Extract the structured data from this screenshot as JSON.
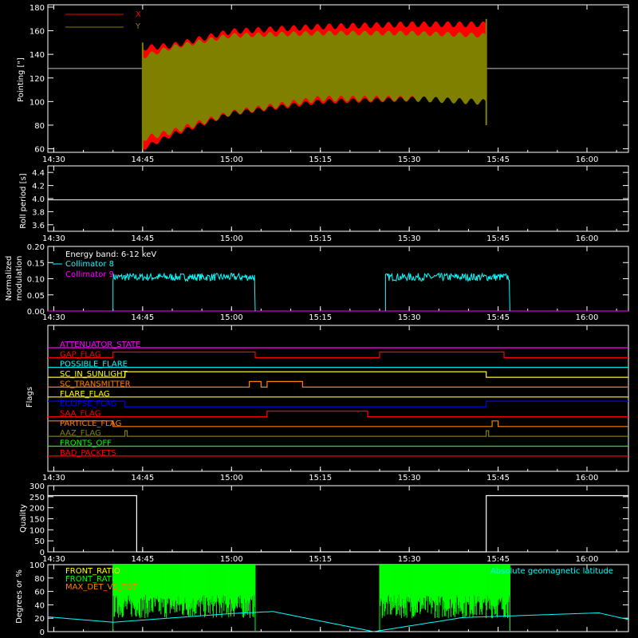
{
  "x_ticks": [
    "14:30",
    "14:45",
    "15:00",
    "15:15",
    "15:30",
    "15:45",
    "16:00"
  ],
  "colors": {
    "background": "#000000",
    "axes": "#ffffff",
    "red": "#ff0000",
    "olive": "#808000",
    "cyan": "#00ffff",
    "magenta": "#ff00ff",
    "orange": "#ff8000",
    "yellow": "#ffff00",
    "blue": "#0000ff",
    "green": "#00ff00",
    "white": "#ffffff"
  },
  "chart_data": [
    {
      "id": "pointing",
      "type": "area",
      "ylabel": "Pointing [\"]",
      "ylim": [
        57,
        182
      ],
      "yticks": [
        60,
        80,
        100,
        120,
        140,
        160,
        180
      ],
      "xlim": [
        "14:29",
        "16:07"
      ],
      "reference_line": 128,
      "legend": [
        "X",
        "Y"
      ],
      "series": [
        {
          "name": "X",
          "color": "red",
          "start": "14:45",
          "end": "15:43",
          "envelope_time": [
            "14:45",
            "14:50",
            "15:00",
            "15:15",
            "15:30",
            "15:43"
          ],
          "upper": [
            148,
            150,
            162,
            166,
            168,
            168
          ],
          "lower": [
            58,
            70,
            88,
            98,
            100,
            102
          ]
        },
        {
          "name": "Y",
          "color": "olive",
          "start": "14:45",
          "end": "15:43",
          "envelope_time": [
            "14:45",
            "14:50",
            "15:00",
            "15:15",
            "15:30",
            "15:43"
          ],
          "upper": [
            140,
            148,
            158,
            160,
            160,
            158
          ],
          "lower": [
            66,
            72,
            88,
            100,
            100,
            97
          ]
        }
      ]
    },
    {
      "id": "roll",
      "type": "line",
      "ylabel": "Roll period [s]",
      "ylim": [
        3.5,
        4.5
      ],
      "yticks": [
        "3.6",
        "3.8",
        "4.0",
        "4.2",
        "4.4"
      ],
      "series": [
        {
          "name": "roll",
          "color": "white",
          "x": [
            "14:29",
            "16:07"
          ],
          "y": [
            3.98,
            3.98
          ]
        }
      ]
    },
    {
      "id": "modulation",
      "type": "line",
      "ylabel": "Normalized modulation",
      "ylim": [
        0.0,
        0.2
      ],
      "yticks": [
        "0.00",
        "0.05",
        "0.10",
        "0.15",
        "0.20"
      ],
      "annotation": "Energy band: 6-12 keV",
      "series": [
        {
          "name": "Collimator 8",
          "color": "cyan",
          "active": [
            [
              "14:40",
              "15:04"
            ],
            [
              "15:26",
              "15:47"
            ]
          ],
          "level": 0.105,
          "spread": 0.012
        },
        {
          "name": "Collimator 9",
          "color": "magenta",
          "x": [
            "14:29",
            "16:07"
          ],
          "y": [
            0.0,
            0.0
          ]
        }
      ]
    },
    {
      "id": "flags",
      "type": "line",
      "ylabel": "Flags",
      "series": [
        {
          "name": "ATTENUATOR_STATE",
          "color": "magenta",
          "steps": [
            [
              "14:29",
              0
            ]
          ]
        },
        {
          "name": "GAP_FLAG",
          "color": "red",
          "steps": [
            [
              "14:29",
              0
            ],
            [
              "14:40",
              1
            ],
            [
              "15:04",
              0
            ],
            [
              "15:25",
              1
            ],
            [
              "15:46",
              0
            ]
          ]
        },
        {
          "name": "POSSIBLE_FLARE",
          "color": "cyan",
          "steps": [
            [
              "14:29",
              0
            ]
          ]
        },
        {
          "name": "SC_IN_SUNLIGHT",
          "color": "yellow",
          "steps": [
            [
              "14:29",
              0
            ],
            [
              "14:42",
              1
            ],
            [
              "15:43",
              0
            ]
          ]
        },
        {
          "name": "SC_TRANSMITTER",
          "color": "orange",
          "steps": [
            [
              "14:29",
              0
            ],
            [
              "15:03",
              1
            ],
            [
              "15:05",
              0
            ],
            [
              "15:06",
              1
            ],
            [
              "15:12",
              0
            ]
          ]
        },
        {
          "name": "FLARE_FLAG",
          "color": "yellow",
          "steps": [
            [
              "14:29",
              0
            ]
          ]
        },
        {
          "name": "ECLIPSE_FLAG",
          "color": "blue",
          "steps": [
            [
              "14:29",
              1
            ],
            [
              "14:42",
              0
            ],
            [
              "15:43",
              1
            ]
          ]
        },
        {
          "name": "SAA_FLAG",
          "color": "red",
          "steps": [
            [
              "14:29",
              0
            ],
            [
              "15:06",
              1
            ],
            [
              "15:23",
              0
            ]
          ]
        },
        {
          "name": "PARTICLE_FLAG",
          "color": "orange",
          "steps": [
            [
              "14:29",
              1
            ],
            [
              "14:40",
              0
            ],
            [
              "15:44",
              1
            ],
            [
              "15:45",
              0
            ]
          ]
        },
        {
          "name": "AAZ_FLAG",
          "color": "olive",
          "steps": [
            [
              "14:29",
              0
            ],
            [
              "14:42",
              1
            ],
            [
              "14:42.4",
              0
            ],
            [
              "15:43",
              1
            ],
            [
              "15:43.4",
              0
            ]
          ]
        },
        {
          "name": "FRONTS_OFF",
          "color": "green",
          "steps": [
            [
              "14:29",
              0
            ]
          ]
        },
        {
          "name": "BAD_PACKETS",
          "color": "red",
          "steps": [
            [
              "14:29",
              0
            ]
          ]
        }
      ]
    },
    {
      "id": "quality",
      "type": "line",
      "ylabel": "Quality",
      "ylim": [
        0,
        300
      ],
      "yticks": [
        "0",
        "50",
        "100",
        "150",
        "200",
        "250",
        "300"
      ],
      "series": [
        {
          "name": "quality",
          "color": "white",
          "x": [
            "14:29",
            "14:44",
            "14:44",
            "15:43",
            "15:43",
            "16:07"
          ],
          "y": [
            255,
            255,
            0,
            0,
            255,
            255
          ]
        }
      ]
    },
    {
      "id": "geomag",
      "type": "line",
      "ylabel": "Degrees or %",
      "ylim": [
        0,
        100
      ],
      "yticks": [
        "0",
        "20",
        "40",
        "60",
        "80",
        "100"
      ],
      "legend": [
        "FRONT_RATIO",
        "FRONT_RATIO",
        "MAX_DET_VS_TOT"
      ],
      "right_annotation": "Absolute geomagnetic latitude",
      "series": [
        {
          "name": "FRONT_RATIO",
          "color": "yellow",
          "values": []
        },
        {
          "name": "FRONT_RATIO",
          "color": "green",
          "active": [
            [
              "14:40",
              "15:04"
            ],
            [
              "15:25",
              "15:47"
            ]
          ],
          "min": 20,
          "max": 100
        },
        {
          "name": "MAX_DET_VS_TOT",
          "color": "orange",
          "values": []
        },
        {
          "name": "Absolute geomagnetic latitude",
          "color": "cyan",
          "x": [
            "14:29",
            "14:40",
            "15:00",
            "15:07",
            "15:24",
            "15:39",
            "16:02",
            "16:07"
          ],
          "y": [
            22,
            14,
            27,
            30,
            0,
            21,
            28,
            18
          ]
        }
      ]
    }
  ]
}
